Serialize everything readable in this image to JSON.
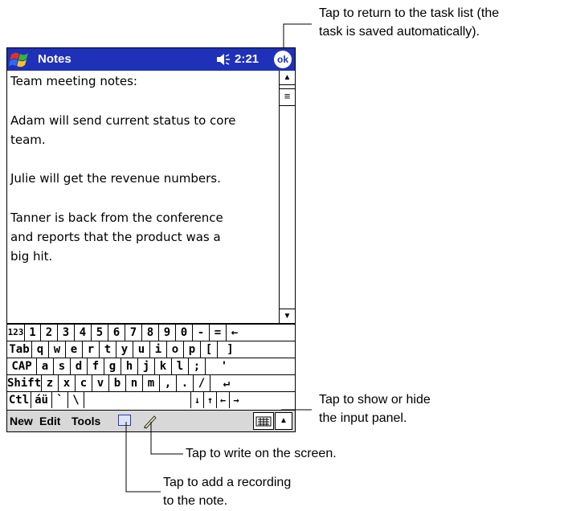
{
  "titlebar": {
    "app_name": "Notes",
    "time": "2:21",
    "ok_label": "ok"
  },
  "note": {
    "lines": [
      "Team meeting  notes:",
      "",
      "Adam will send current  status to core",
      "team.",
      "",
      "Julie will get the revenue numbers.",
      "",
      "Tanner is back from the conference",
      "and reports that the product was a",
      "big hit."
    ]
  },
  "keyboard": {
    "row1": [
      "123",
      "1",
      "2",
      "3",
      "4",
      "5",
      "6",
      "7",
      "8",
      "9",
      "0",
      "-",
      "=",
      "←"
    ],
    "row2": [
      "Tab",
      "q",
      "w",
      "e",
      "r",
      "t",
      "y",
      "u",
      "i",
      "o",
      "p",
      "[",
      "]"
    ],
    "row3": [
      "CAP",
      "a",
      "s",
      "d",
      "f",
      "g",
      "h",
      "j",
      "k",
      "l",
      ";",
      "'"
    ],
    "row4": [
      "Shift",
      "z",
      "x",
      "c",
      "v",
      "b",
      "n",
      "m",
      ",",
      ".",
      "/",
      "↵"
    ],
    "row5": [
      "Ctl",
      "áü",
      "`",
      "\\",
      "",
      "↓",
      "↑",
      "←",
      "→"
    ]
  },
  "menubar": {
    "new": "New",
    "edit": "Edit",
    "tools": "Tools"
  },
  "callouts": {
    "ok_line1": "Tap to return to the task list (the",
    "ok_line2": "task is saved automatically).",
    "input_line1": "Tap to show or hide",
    "input_line2": "the input panel.",
    "write": "Tap to write on the screen.",
    "record_line1": "Tap to add a recording",
    "record_line2": "to the note."
  },
  "icons": {
    "start": "windows-flag-icon",
    "speaker": "speaker-icon",
    "recording": "recording-icon",
    "pen": "pen-icon",
    "keyboard": "keyboard-icon"
  },
  "colors": {
    "titlebar": "#1f31b8",
    "menubar": "#d8d8d8"
  }
}
